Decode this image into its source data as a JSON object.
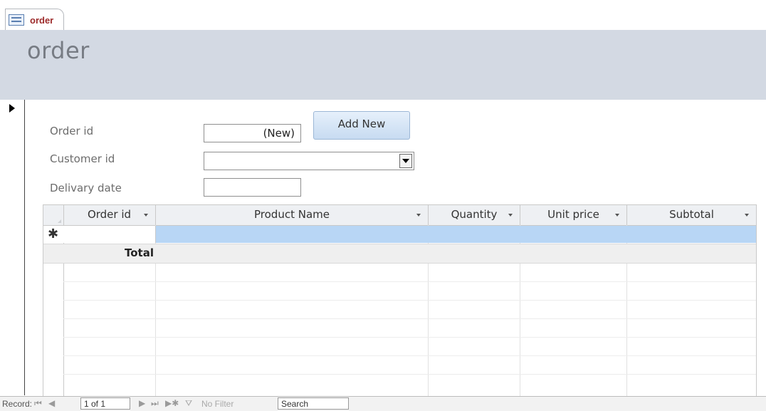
{
  "tab": {
    "label": "order",
    "icon": "form-icon"
  },
  "form": {
    "title": "order"
  },
  "fields": {
    "order_id": {
      "label": "Order id",
      "value": "(New)"
    },
    "customer_id": {
      "label": "Customer id",
      "value": ""
    },
    "delivery_date": {
      "label": "Delivary date",
      "value": ""
    }
  },
  "add_button": {
    "label": "Add New"
  },
  "subform": {
    "columns": [
      "Order id",
      "Product Name",
      "Quantity",
      "Unit price",
      "Subtotal"
    ],
    "new_row_marker": "✱",
    "total_label": "Total"
  },
  "nav": {
    "record_label": "Record:",
    "record_value": "1 of 1",
    "filter_label": "No Filter",
    "search_placeholder": "Search"
  }
}
